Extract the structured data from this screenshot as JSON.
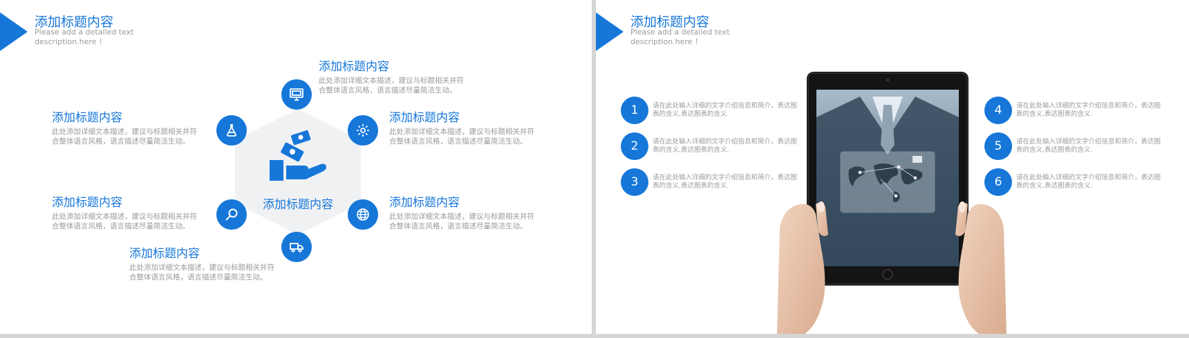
{
  "header": {
    "title": "添加标题内容",
    "description": "Please add a detailed text description here ！"
  },
  "left_slide": {
    "center_label": "添加标题内容",
    "features": [
      {
        "title": "添加标题内容",
        "desc": "此处添加详细文本描述，建议与标题相关并符合整体语言风格，语言描述尽量简洁生动。"
      },
      {
        "title": "添加标题内容",
        "desc": "此处添加详细文本描述，建议与标题相关并符合整体语言风格，语言描述尽量简洁生动。"
      },
      {
        "title": "添加标题内容",
        "desc": "此处添加详细文本描述，建议与标题相关并符合整体语言风格，语言描述尽量简洁生动。"
      },
      {
        "title": "添加标题内容",
        "desc": "此处添加详细文本描述，建议与标题相关并符合整体语言风格，语言描述尽量简洁生动。"
      },
      {
        "title": "添加标题内容",
        "desc": "此处添加详细文本描述，建议与标题相关并符合整体语言风格，语言描述尽量简洁生动。"
      },
      {
        "title": "添加标题内容",
        "desc": "此处添加详细文本描述，建议与标题相关并符合整体语言风格，语言描述尽量简洁生动。"
      }
    ],
    "icons": [
      "monitor-icon",
      "gear-icon",
      "globe-icon",
      "truck-icon",
      "search-icon",
      "flask-icon",
      "money-hand-icon"
    ]
  },
  "right_slide": {
    "items": [
      {
        "number": "1",
        "desc": "请在此处输入详细的文字介绍信息和简介，表达图表的含义,表达图表的含义."
      },
      {
        "number": "2",
        "desc": "请在此处输入详细的文字介绍信息和简介，表达图表的含义,表达图表的含义."
      },
      {
        "number": "3",
        "desc": "请在此处输入详细的文字介绍信息和简介，表达图表的含义,表达图表的含义."
      },
      {
        "number": "4",
        "desc": "请在此处输入详细的文字介绍信息和简介，表达图表的含义,表达图表的含义."
      },
      {
        "number": "5",
        "desc": "请在此处输入详细的文字介绍信息和简介，表达图表的含义,表达图表的含义."
      },
      {
        "number": "6",
        "desc": "请在此处输入详细的文字介绍信息和简介，表达图表的含义,表达图表的含义."
      }
    ]
  },
  "colors": {
    "accent": "#1677d9",
    "muted_text": "#9a9a9a",
    "hexagon_fill": "#f0f1f3"
  }
}
